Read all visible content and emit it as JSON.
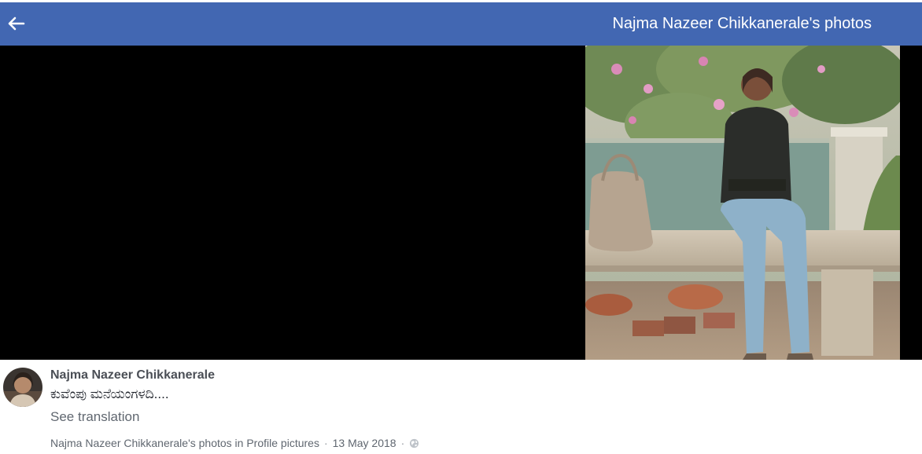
{
  "header": {
    "title": "Najma Nazeer Chikkanerale's photos",
    "back_icon": "arrow-left-icon",
    "background": "#4267b2"
  },
  "post": {
    "author": "Najma Nazeer Chikkanerale",
    "text": "ಕುವೆಂಪು ಮನೆಯಂಗಳದಿ....",
    "see_translation": "See translation",
    "album_link": "Najma Nazeer Chikkanerale's photos in Profile pictures",
    "separator": "·",
    "date": "13 May 2018",
    "privacy_icon": "globe-icon"
  },
  "colors": {
    "brand": "#4267b2",
    "viewer_background": "#000000",
    "secondary_text": "#606770"
  }
}
